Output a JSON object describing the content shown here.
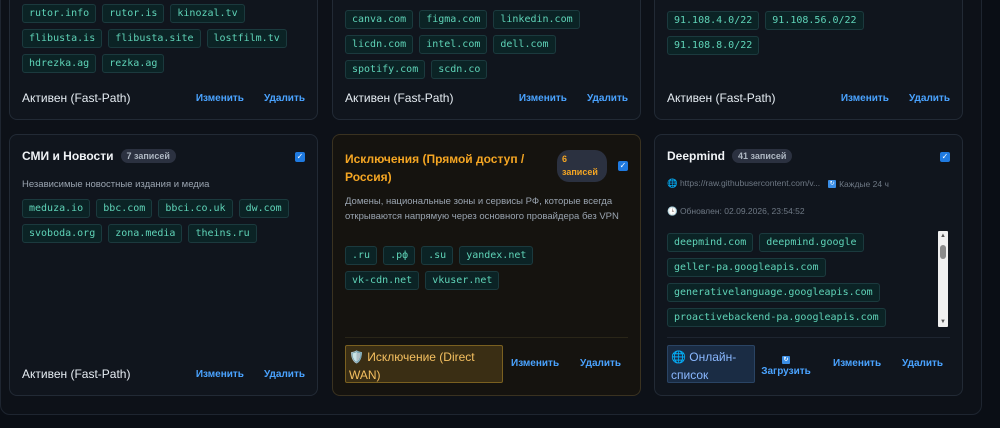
{
  "cards": {
    "torrents": {
      "tags": [
        "rutor.info",
        "rutor.is",
        "kinozal.tv",
        "flibusta.is",
        "flibusta.site",
        "lostfilm.tv",
        "hdrezka.ag",
        "rezka.ag"
      ],
      "status": "Активен (Fast-Path)",
      "edit": "Изменить",
      "delete": "Удалить"
    },
    "services": {
      "tags": [
        "canva.com",
        "figma.com",
        "linkedin.com",
        "licdn.com",
        "intel.com",
        "dell.com",
        "spotify.com",
        "scdn.co"
      ],
      "status": "Активен (Fast-Path)",
      "edit": "Изменить",
      "delete": "Удалить"
    },
    "subnets": {
      "tags": [
        "91.108.4.0/22",
        "91.108.56.0/22",
        "91.108.8.0/22"
      ],
      "status": "Активен (Fast-Path)",
      "edit": "Изменить",
      "delete": "Удалить"
    },
    "media": {
      "title": "СМИ и Новости",
      "count": "7 записей",
      "desc": "Независимые новостные издания и медиа",
      "tags": [
        "meduza.io",
        "bbc.com",
        "bbci.co.uk",
        "dw.com",
        "svoboda.org",
        "zona.media",
        "theins.ru"
      ],
      "status": "Активен (Fast-Path)",
      "edit": "Изменить",
      "delete": "Удалить"
    },
    "exceptions": {
      "title": "Исключения (Прямой доступ / Россия)",
      "count": "6 записей",
      "desc": "Домены, национальные зоны и сервисы РФ, которые всегда открываются напрямую через основного провайдера без VPN",
      "tags": [
        ".ru",
        ".рф",
        ".su",
        "yandex.net",
        "vk-cdn.net",
        "vkuser.net"
      ],
      "mode": "🛡️ Исключение (Direct WAN)",
      "edit": "Изменить",
      "delete": "Удалить"
    },
    "deepmind": {
      "title": "Deepmind",
      "count": "41 записей",
      "source_url": "🌐 https://raw.githubusercontent.com/v...",
      "interval": "Каждые 24 ч",
      "updated": "🕒 Обновлен: 02.09.2026, 23:54:52",
      "tags": [
        "deepmind.com",
        "deepmind.google",
        "geller-pa.googleapis.com",
        "generativelanguage.googleapis.com",
        "proactivebackend-pa.googleapis.com"
      ],
      "mode": "🌐 Онлайн-список",
      "load": "Загрузить",
      "edit": "Изменить",
      "delete": "Удалить"
    }
  },
  "icons": {
    "checkbox": "✓",
    "refresh": "🔄"
  },
  "colors": {
    "accent_link": "#4aa3ff",
    "tag_text": "#5fd4b8",
    "exception_title": "#f5a623",
    "checkbox": "#1f7ae0"
  }
}
